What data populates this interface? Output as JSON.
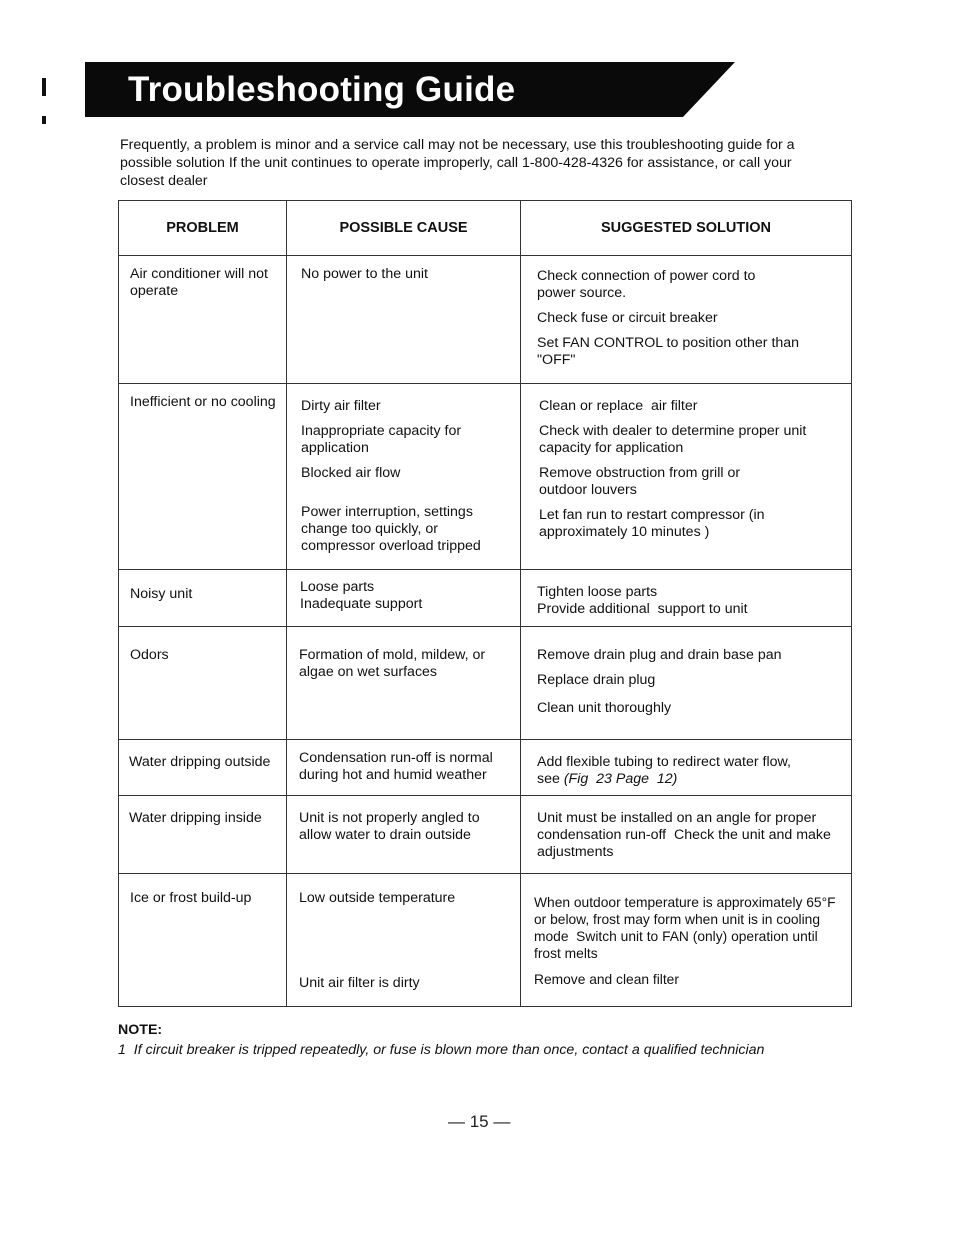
{
  "header": {
    "title": "Troubleshooting Guide"
  },
  "intro": "Frequently, a problem is minor and a service call may not be necessary, use this troubleshooting guide for a\npossible solution  If the unit continues to operate improperly, call 1-800-428-4326 for assistance, or call your\nclosest dealer",
  "table": {
    "headers": [
      "PROBLEM",
      "POSSIBLE CAUSE",
      "SUGGESTED SOLUTION"
    ],
    "rows": [
      {
        "problem": "Air conditioner will not operate",
        "causes": [
          "No power to the unit"
        ],
        "solutions": [
          "Check connection of power cord to power source.",
          "Check fuse or circuit breaker",
          "Set FAN CONTROL to position other than \"OFF\""
        ]
      },
      {
        "problem": "Inefficient or no cooling",
        "causes": [
          "Dirty air filter",
          "Inappropriate capacity for application",
          "Blocked air flow",
          "Power interruption, settings change too quickly, or compressor overload tripped"
        ],
        "solutions": [
          "Clean or replace  air filter",
          "Check with dealer to determine proper unit capacity for application",
          "Remove obstruction from grill or outdoor louvers",
          "Let fan run to restart compressor (in approximately 10 minutes )"
        ]
      },
      {
        "problem": "Noisy unit",
        "causes": [
          "Loose parts",
          "Inadequate support"
        ],
        "solutions": [
          "Tighten loose parts",
          "Provide additional  support to unit"
        ]
      },
      {
        "problem": "Odors",
        "causes": [
          "Formation of mold, mildew, or algae on wet surfaces"
        ],
        "solutions": [
          "Remove drain plug and drain base pan",
          "Replace drain plug",
          "Clean unit thoroughly"
        ]
      },
      {
        "problem": "Water dripping outside",
        "causes": [
          "Condensation run-off is normal during hot and humid weather"
        ],
        "solutions": [
          "Add flexible tubing to redirect water flow,"
        ],
        "solution_ref_prefix": "see ",
        "solution_ref": "(Fig  23 Page  12)"
      },
      {
        "problem": "Water dripping inside",
        "causes": [
          "Unit is not properly angled to allow water to drain outside"
        ],
        "solutions": [
          "Unit must be installed on an angle for proper condensation run-off  Check the unit and make adjustments"
        ]
      },
      {
        "problem": "Ice or frost build-up",
        "causes": [
          "Low outside temperature",
          "Unit air filter is dirty"
        ],
        "solutions": [
          "When outdoor temperature is approximately 65°F or below, frost may form when unit is in cooling mode  Switch unit to FAN (only) operation until frost melts",
          "Remove and clean filter"
        ]
      }
    ]
  },
  "note": {
    "label": "NOTE:",
    "text": "1  If circuit breaker is tripped repeatedly, or fuse is blown more than once, contact a qualified technician"
  },
  "page_number": "— 15 —"
}
